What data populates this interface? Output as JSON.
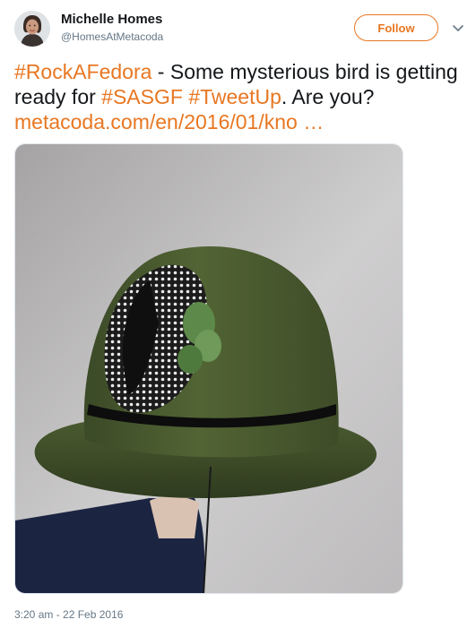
{
  "author": {
    "name": "Michelle Homes",
    "handle": "@HomesAtMetacoda",
    "avatar": "profile-photo"
  },
  "follow_button": {
    "label": "Follow"
  },
  "menu": {
    "icon": "chevron-down-icon"
  },
  "tweet": {
    "hashtag_rock": "#RockAFedora",
    "text_1": " - Some mysterious bird is getting ready for ",
    "hashtag_sasgf": "#SASGF",
    "text_2": " ",
    "hashtag_tweetup": "#TweetUp",
    "text_3": ". Are you? ",
    "link": "metacoda.com/en/2016/01/kno …"
  },
  "media": {
    "description": "photo"
  },
  "timestamp": "3:20 am - 22 Feb 2016",
  "colors": {
    "accent": "#e87722",
    "text": "#14171a",
    "muted": "#657786"
  }
}
